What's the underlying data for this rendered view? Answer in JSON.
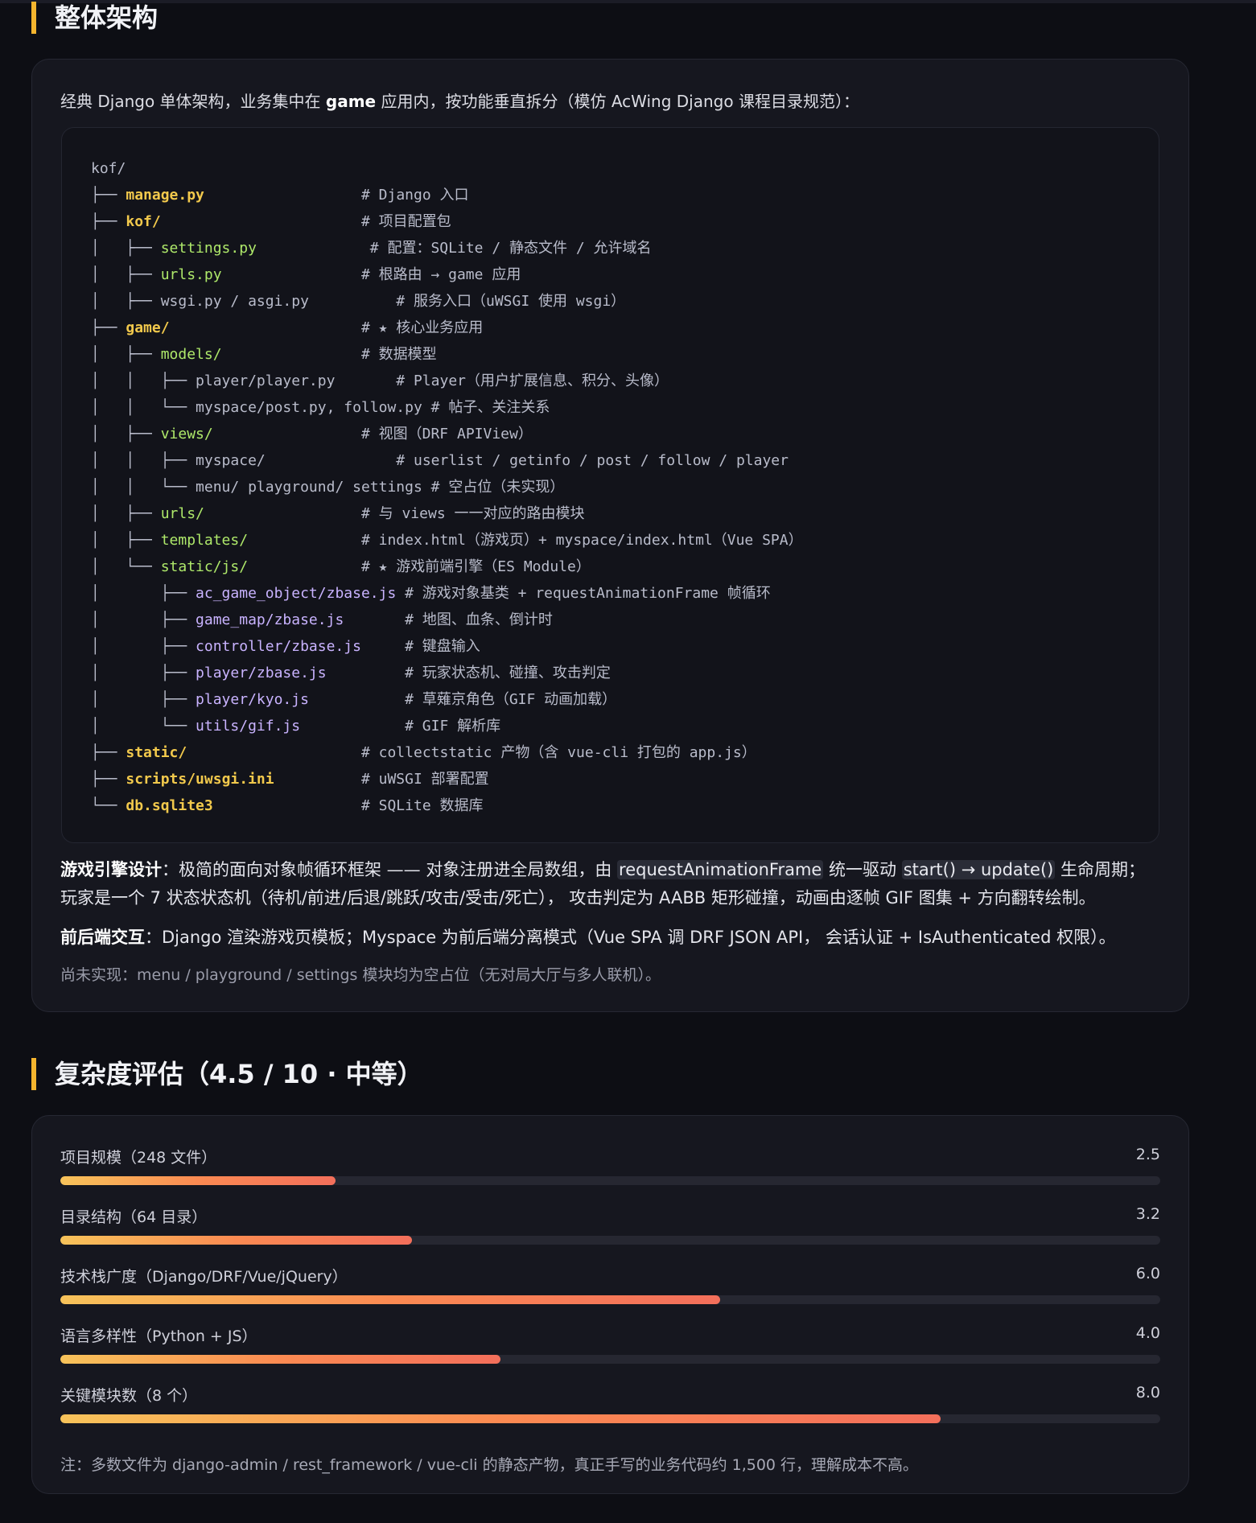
{
  "arch_section": {
    "title": "整体架构",
    "intro": {
      "part1": "经典 Django 单体架构，业务集中在 ",
      "bold": "game",
      "part2": " 应用内，按功能垂直拆分（模仿 AcWing Django 课程目录规范）："
    },
    "tree": [
      {
        "prefix": "",
        "name": "kof/",
        "style": "plain",
        "comment": ""
      },
      {
        "prefix": "├── ",
        "name": "manage.py",
        "style": "d",
        "comment": "                  # Django 入口"
      },
      {
        "prefix": "├── ",
        "name": "kof/",
        "style": "d",
        "comment": "                       # 项目配置包"
      },
      {
        "prefix": "│   ├── ",
        "name": "settings.py",
        "style": "g",
        "comment": "             # 配置：SQLite / 静态文件 / 允许域名"
      },
      {
        "prefix": "│   ├── ",
        "name": "urls.py",
        "style": "g",
        "comment": "                # 根路由 → game 应用"
      },
      {
        "prefix": "│   ├── ",
        "name": "wsgi.py / asgi.py",
        "style": "plain",
        "comment": "          # 服务入口（uWSGI 使用 wsgi）"
      },
      {
        "prefix": "├── ",
        "name": "game/",
        "style": "d",
        "comment": "                      # ★ 核心业务应用"
      },
      {
        "prefix": "│   ├── ",
        "name": "models/",
        "style": "g",
        "comment": "                # 数据模型"
      },
      {
        "prefix": "│   │   ├── ",
        "name": "player/player.py",
        "style": "plain",
        "comment": "       # Player（用户扩展信息、积分、头像）"
      },
      {
        "prefix": "│   │   └── ",
        "name": "myspace/post.py, follow.py",
        "style": "plain",
        "comment": " # 帖子、关注关系"
      },
      {
        "prefix": "│   ├── ",
        "name": "views/",
        "style": "g",
        "comment": "                 # 视图（DRF APIView）"
      },
      {
        "prefix": "│   │   ├── ",
        "name": "myspace/",
        "style": "plain",
        "comment": "               # userlist / getinfo / post / follow / player"
      },
      {
        "prefix": "│   │   └── ",
        "name": "menu/ playground/ settings",
        "style": "plain",
        "comment": " # 空占位（未实现）"
      },
      {
        "prefix": "│   ├── ",
        "name": "urls/",
        "style": "g",
        "comment": "                  # 与 views 一一对应的路由模块"
      },
      {
        "prefix": "│   ├── ",
        "name": "templates/",
        "style": "g",
        "comment": "             # index.html（游戏页）+ myspace/index.html（Vue SPA）"
      },
      {
        "prefix": "│   └── ",
        "name": "static/js/",
        "style": "g",
        "comment": "             # ★ 游戏前端引擎（ES Module）"
      },
      {
        "prefix": "│       ├── ",
        "name": "ac_game_object/zbase.js",
        "style": "b",
        "comment": " # 游戏对象基类 + requestAnimationFrame 帧循环"
      },
      {
        "prefix": "│       ├── ",
        "name": "game_map/zbase.js",
        "style": "b",
        "comment": "       # 地图、血条、倒计时"
      },
      {
        "prefix": "│       ├── ",
        "name": "controller/zbase.js",
        "style": "b",
        "comment": "     # 键盘输入"
      },
      {
        "prefix": "│       ├── ",
        "name": "player/zbase.js",
        "style": "b",
        "comment": "         # 玩家状态机、碰撞、攻击判定"
      },
      {
        "prefix": "│       ├── ",
        "name": "player/kyo.js",
        "style": "b",
        "comment": "           # 草薙京角色（GIF 动画加载）"
      },
      {
        "prefix": "│       └── ",
        "name": "utils/gif.js",
        "style": "b",
        "comment": "            # GIF 解析库"
      },
      {
        "prefix": "├── ",
        "name": "static/",
        "style": "d",
        "comment": "                    # collectstatic 产物（含 vue-cli 打包的 app.js）"
      },
      {
        "prefix": "├── ",
        "name": "scripts/uwsgi.ini",
        "style": "d",
        "comment": "          # uWSGI 部署配置"
      },
      {
        "prefix": "└── ",
        "name": "db.sqlite3",
        "style": "d",
        "comment": "                 # SQLite 数据库"
      }
    ],
    "engine": {
      "label": "游戏引擎设计",
      "t1": "：极简的面向对象帧循环框架 —— 对象注册进全局数组，由 ",
      "code1": "requestAnimationFrame",
      "t2": " 统一驱动 ",
      "code2": "start() → update()",
      "t3": " 生命周期； 玩家是一个 7 状态状态机（待机/前进/后退/跳跃/攻击/受击/死亡）， 攻击判定为 AABB 矩形碰撞，动画由逐帧 GIF 图集 + 方向翻转绘制。"
    },
    "interaction": {
      "label": "前后端交互",
      "text": "：Django 渲染游戏页模板；Myspace 为前后端分离模式（Vue SPA 调 DRF JSON API， 会话认证 + IsAuthenticated 权限）。"
    },
    "unimplemented": "尚未实现：menu / playground / settings 模块均为空占位（无对局大厅与多人联机）。"
  },
  "complexity_section": {
    "title": "复杂度评估（4.5 / 10 · 中等）",
    "metrics": [
      {
        "label": "项目规模（248 文件）",
        "value": "2.5",
        "fraction": 0.25
      },
      {
        "label": "目录结构（64 目录）",
        "value": "3.2",
        "fraction": 0.32
      },
      {
        "label": "技术栈广度（Django/DRF/Vue/jQuery）",
        "value": "6.0",
        "fraction": 0.6
      },
      {
        "label": "语言多样性（Python + JS）",
        "value": "4.0",
        "fraction": 0.4
      },
      {
        "label": "关键模块数（8 个）",
        "value": "8.0",
        "fraction": 0.8
      }
    ],
    "note": "注：多数文件为 django-admin / rest_framework / vue-cli 的静态产物，真正手写的业务代码约 1,500 行，理解成本不高。"
  },
  "colors": {
    "accent": "#f5b52e",
    "bar_start": "#f7c35a",
    "bar_end": "#f36f5b"
  }
}
